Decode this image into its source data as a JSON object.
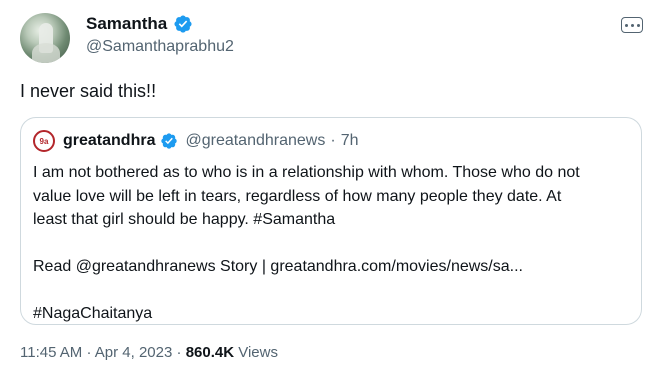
{
  "author": {
    "name": "Samantha",
    "handle": "@Samanthaprabhu2"
  },
  "tweet": {
    "text": "I never said this!!"
  },
  "quoted": {
    "avatar_text": "9a",
    "name": "greatandhra",
    "handle": "@greatandhranews",
    "separator": "·",
    "time": "7h",
    "lines": [
      "I am not bothered as to who is in a relationship with whom. Those who do not",
      "value love will be left in tears, regardless of how many people they date. At",
      "least that girl should be happy. #Samantha",
      "",
      "Read @greatandhranews Story | greatandhra.com/movies/news/sa...",
      "",
      "#NagaChaitanya"
    ]
  },
  "meta": {
    "time": "11:45 AM",
    "separator": "·",
    "date": "Apr 4, 2023",
    "views_count": "860.4K",
    "views_label": "Views"
  },
  "icons": {
    "verified": "verified-badge-icon",
    "more": "more-options-icon"
  },
  "colors": {
    "verified": "#1d9bf0",
    "secondary_text": "#536471",
    "border": "#cfd9de",
    "quoted_avatar": "#b3262b"
  }
}
